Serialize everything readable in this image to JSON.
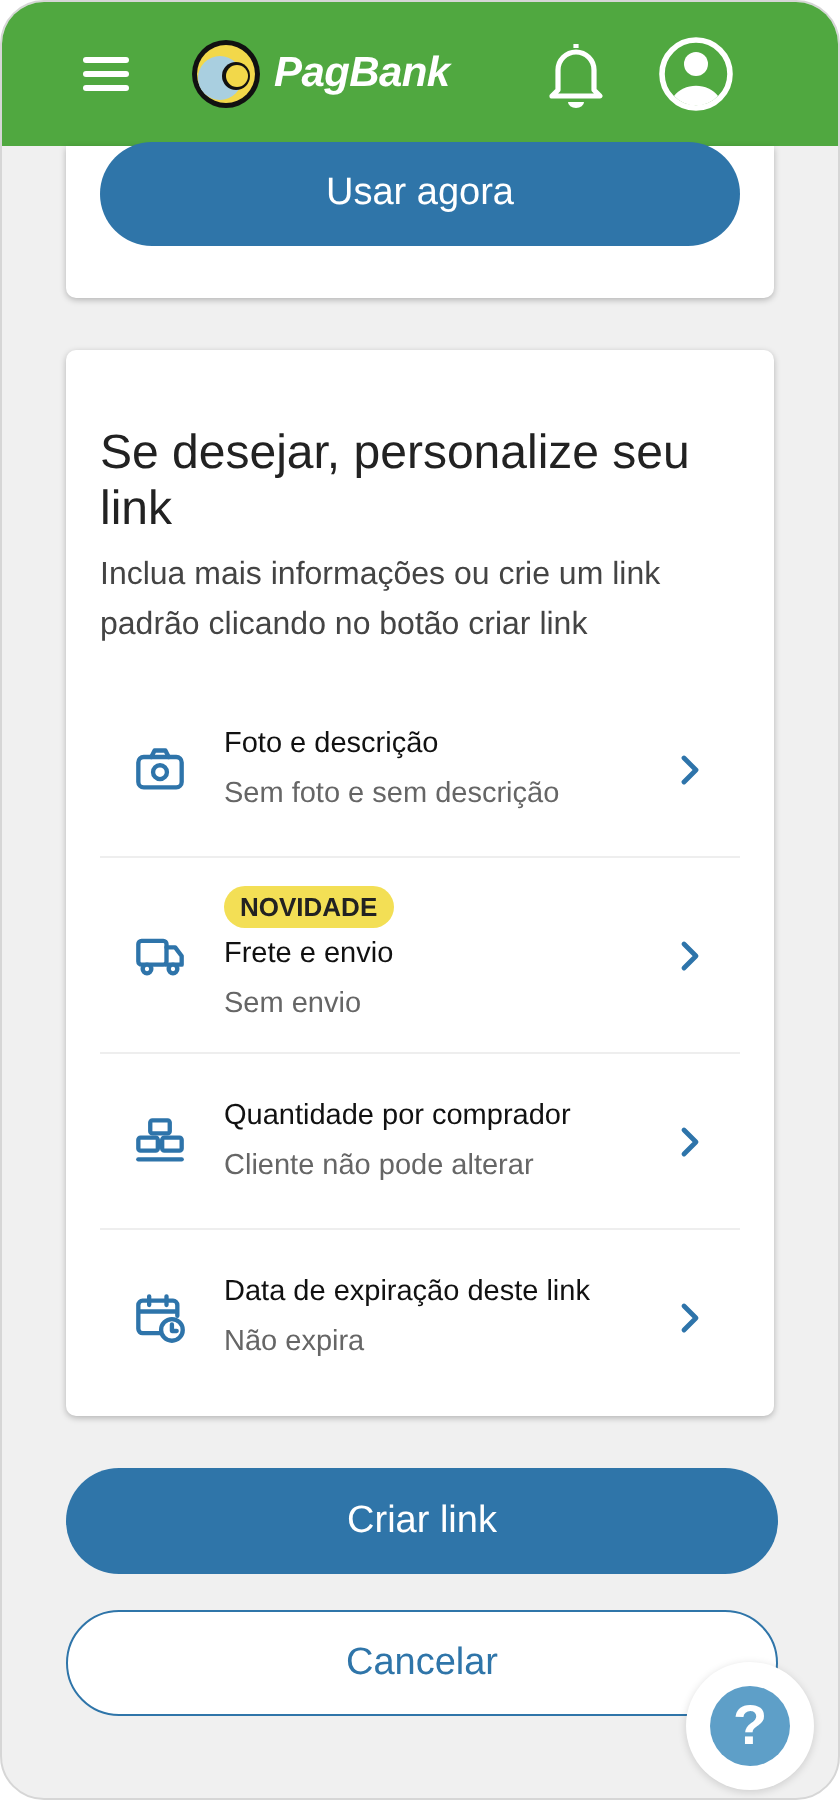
{
  "header": {
    "brand": "PagBank"
  },
  "top_card": {
    "button": "Usar agora"
  },
  "personalize": {
    "title": "Se desejar, personalize seu link",
    "subtitle": "Inclua mais informações ou crie um link padrão clicando no botão criar link",
    "options": [
      {
        "title": "Foto e descrição",
        "detail": "Sem foto e sem descrição"
      },
      {
        "badge": "NOVIDADE",
        "title": "Frete e envio",
        "detail": "Sem envio"
      },
      {
        "title": "Quantidade por comprador",
        "detail": "Cliente não pode alterar"
      },
      {
        "title": "Data de expiração deste link",
        "detail": "Não expira"
      }
    ]
  },
  "actions": {
    "primary": "Criar link",
    "secondary": "Cancelar"
  },
  "help": {
    "label": "?"
  }
}
